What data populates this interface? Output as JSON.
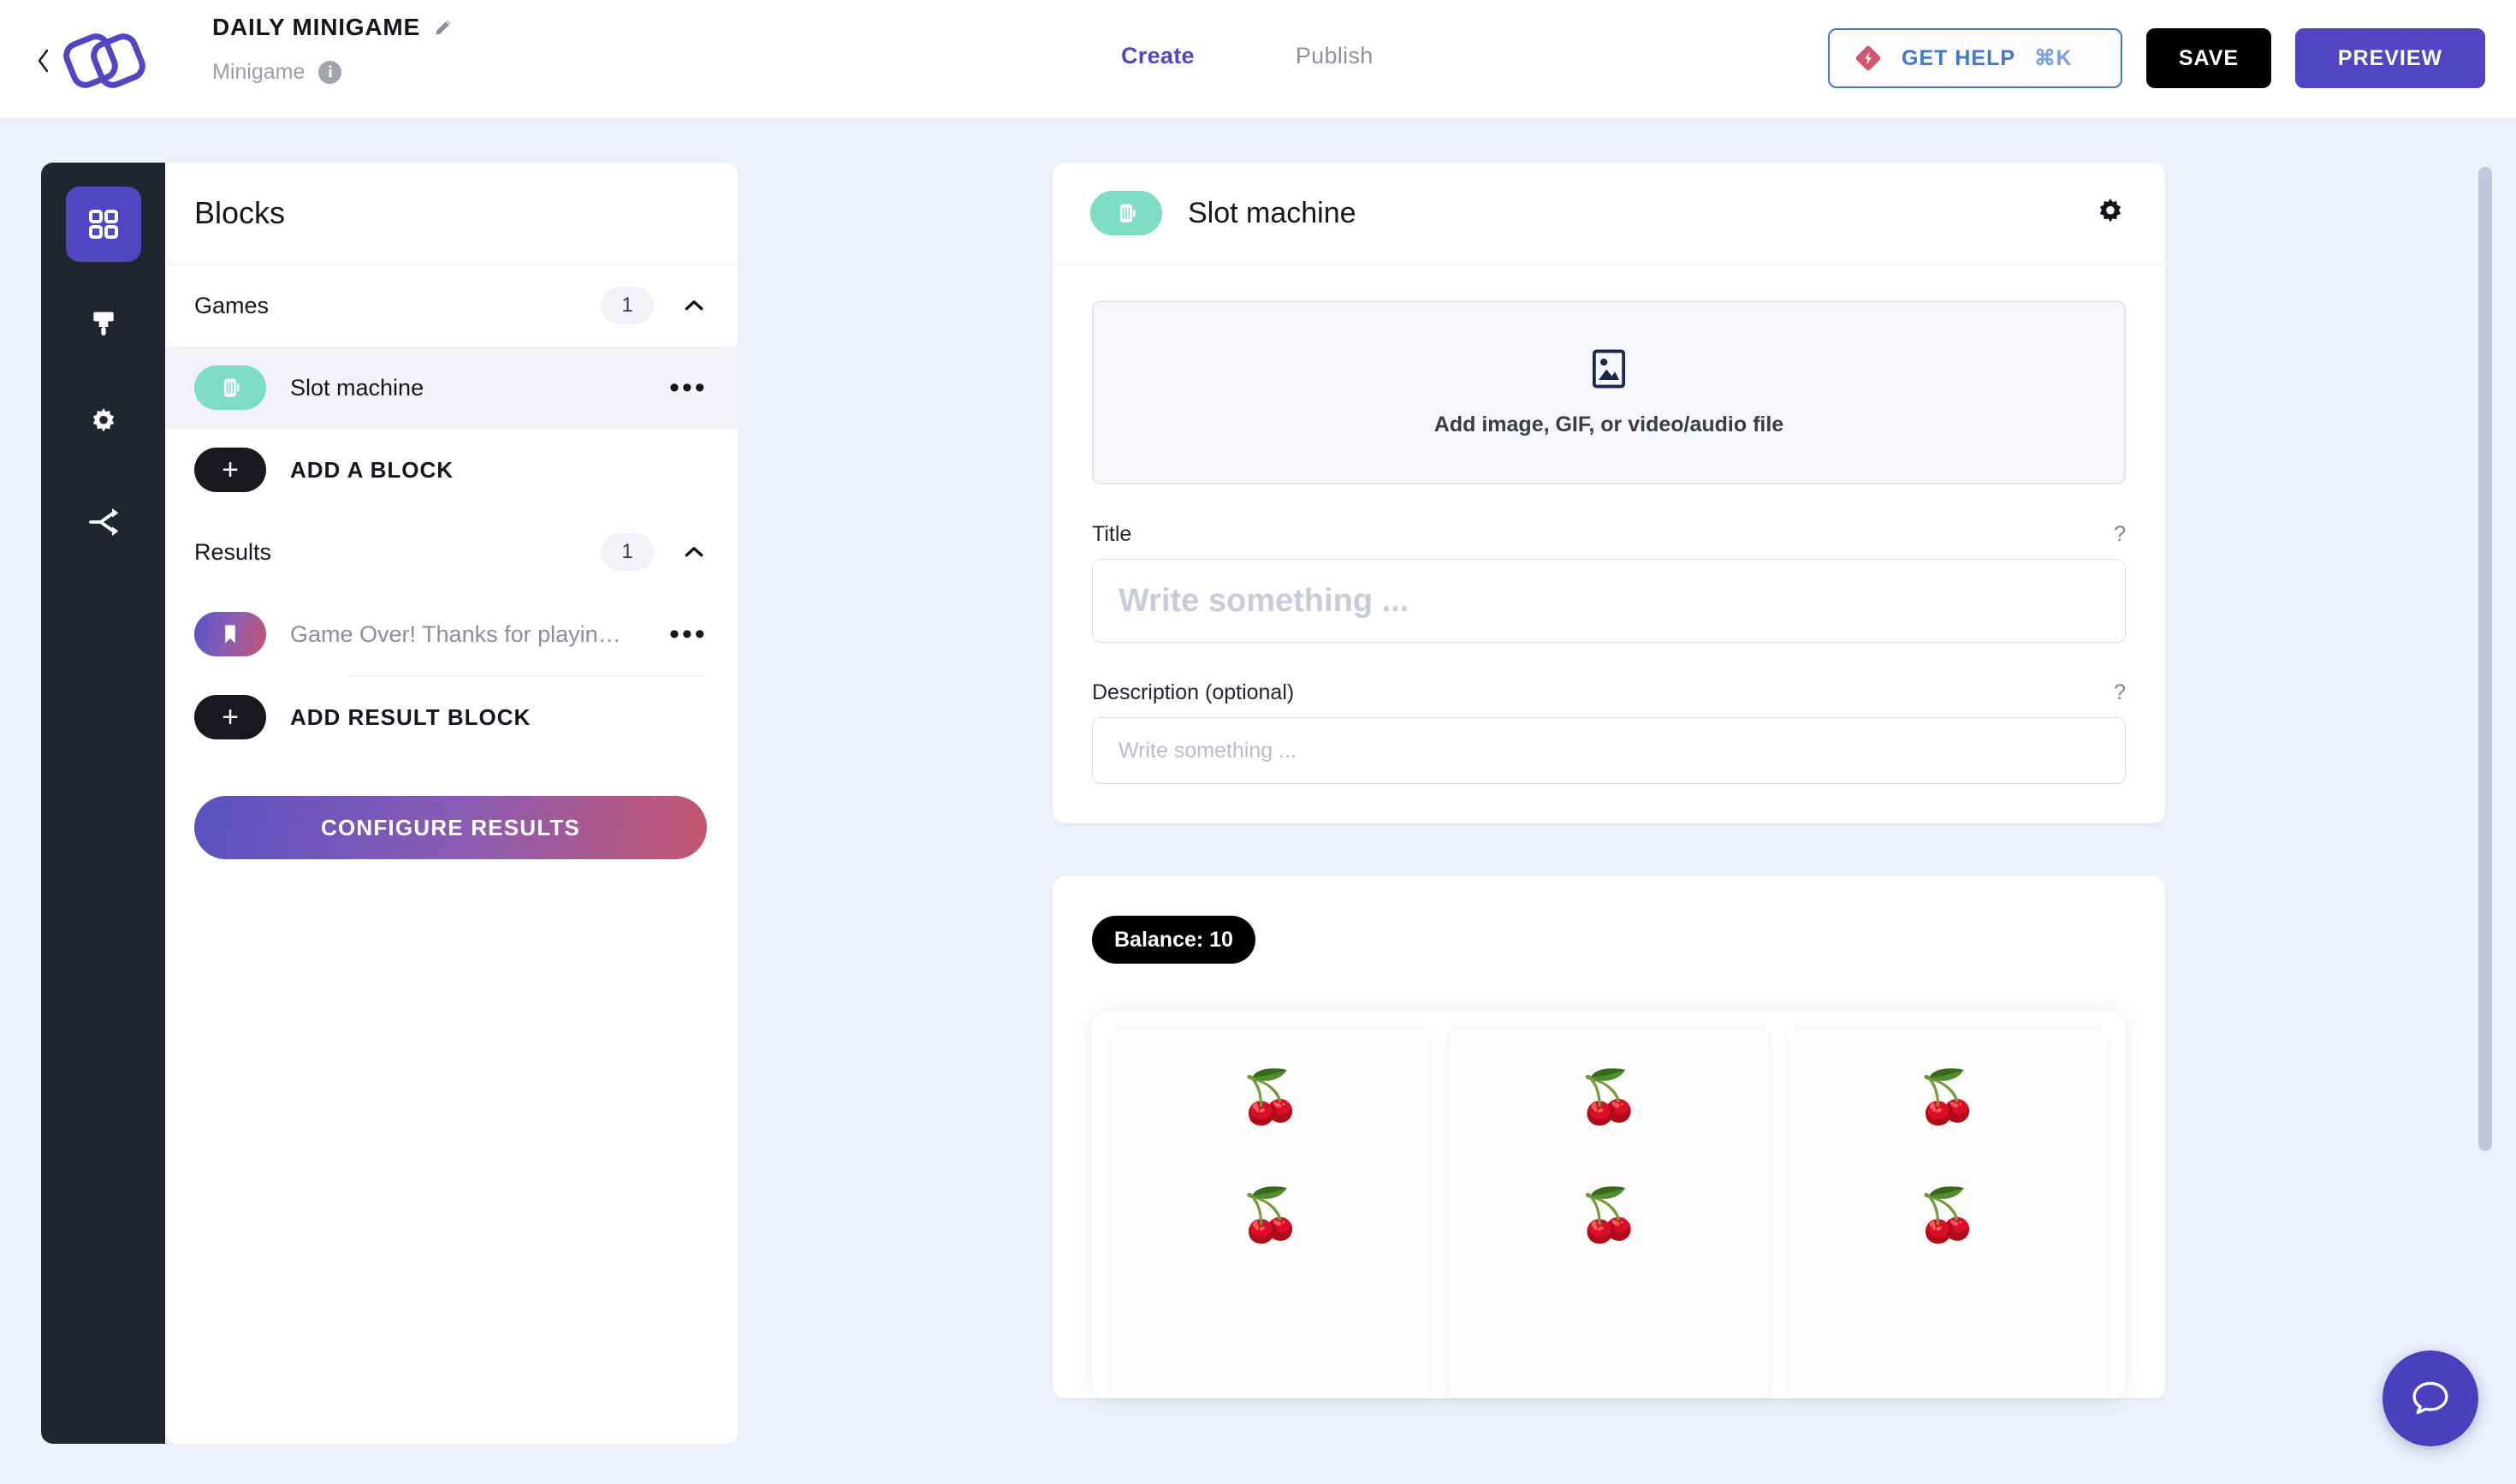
{
  "header": {
    "back_label": "back",
    "logo_name": "app-logo",
    "project_title": "DAILY MINIGAME",
    "edit_icon": "pencil-icon",
    "project_type": "Minigame",
    "info_icon": "info-icon",
    "tabs": [
      {
        "label": "Create",
        "active": true
      },
      {
        "label": "Publish",
        "active": false
      }
    ],
    "help_button": {
      "label": "GET HELP",
      "shortcut": "⌘K",
      "icon": "lightning-diamond-icon"
    },
    "save_label": "SAVE",
    "preview_label": "PREVIEW"
  },
  "rail": {
    "items": [
      {
        "icon": "grid-icon",
        "name": "blocks",
        "active": true
      },
      {
        "icon": "paintbrush-icon",
        "name": "design",
        "active": false
      },
      {
        "icon": "gear-icon",
        "name": "settings",
        "active": false
      },
      {
        "icon": "share-nodes-icon",
        "name": "integrations",
        "active": false
      }
    ]
  },
  "blocks_panel": {
    "title": "Blocks",
    "sections": [
      {
        "name": "Games",
        "count": "1",
        "collapse_icon": "chevron-up-icon",
        "items": [
          {
            "label": "Slot machine",
            "icon": "slot-machine-icon",
            "selected": true,
            "menu_icon": "ellipsis-icon"
          }
        ],
        "add_label": "ADD A BLOCK"
      },
      {
        "name": "Results",
        "count": "1",
        "collapse_icon": "chevron-up-icon",
        "items": [
          {
            "label": "Game Over! Thanks for playin…",
            "icon": "bookmark-icon",
            "selected": false,
            "menu_icon": "ellipsis-icon"
          }
        ],
        "add_label": "ADD RESULT BLOCK"
      }
    ],
    "configure_label": "CONFIGURE RESULTS"
  },
  "editor": {
    "block_title": "Slot machine",
    "block_icon": "slot-machine-icon",
    "settings_icon": "gear-icon",
    "dropzone": {
      "icon": "image-placeholder-icon",
      "label": "Add image, GIF, or video/audio file"
    },
    "title_field": {
      "label": "Title",
      "help": "?",
      "value": "",
      "placeholder": "Write something ..."
    },
    "description_field": {
      "label": "Description (optional)",
      "help": "?",
      "value": "",
      "placeholder": "Write something ..."
    }
  },
  "preview": {
    "balance_label": "Balance: 10",
    "reels": [
      {
        "symbols": [
          "🍒",
          "🍒"
        ]
      },
      {
        "symbols": [
          "🍒",
          "🍒"
        ]
      },
      {
        "symbols": [
          "🍒",
          "🍒"
        ]
      }
    ]
  },
  "chat": {
    "icon": "chat-bubble-icon"
  },
  "colors": {
    "accent": "#5245c4",
    "background": "#edeffb",
    "rail": "#23252e",
    "badge_teal": "#7fddc3",
    "gradient_start": "#5a51c2",
    "gradient_end": "#c4566f",
    "help_blue": "#3f77d6",
    "help_pink": "#d0566f"
  }
}
